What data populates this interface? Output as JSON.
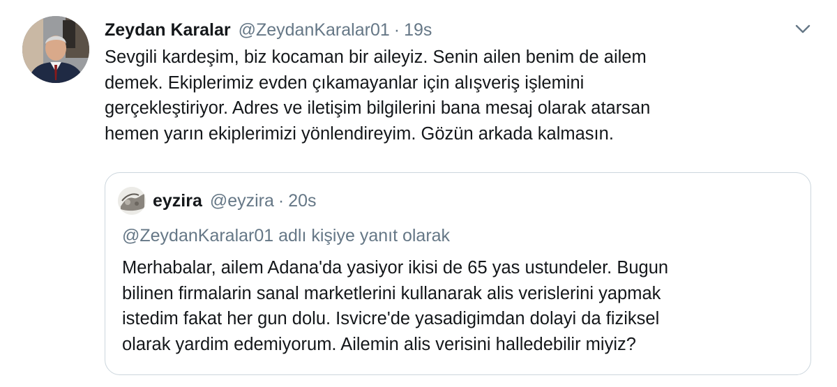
{
  "tweet": {
    "author_name": "Zeydan Karalar",
    "author_handle": "@ZeydanKaralar01",
    "separator": "·",
    "time": "19s",
    "text_lines": [
      "Sevgili kardeşim, biz kocaman bir aileyiz. Senin ailen benim de ailem",
      "demek. Ekiplerimiz evden çıkamayanlar için alışveriş işlemini",
      "gerçekleştiriyor. Adres ve iletişim bilgilerini bana mesaj olarak atarsan",
      "hemen yarın ekiplerimizi yönlendireyim. Gözün arkada kalmasın."
    ]
  },
  "quoted_tweet": {
    "author_name": "eyzira",
    "author_handle": "@eyzira",
    "separator": "·",
    "time": "20s",
    "reply_to": "@ZeydanKaralar01 adlı kişiye yanıt olarak",
    "text_lines": [
      "Merhabalar, ailem Adana'da yasiyor ikisi de 65 yas ustundeler. Bugun",
      "bilinen firmalarin sanal marketlerini kullanarak alis verislerini yapmak",
      "istedim fakat her gun dolu. Isvicre'de yasadigimdan dolayi da fiziksel",
      "olarak yardim edemiyorum. Ailemin alis verisini halledebilir miyiz?"
    ]
  },
  "icons": {
    "menu": "chevron-down-icon",
    "avatar": "profile-photo",
    "quoted_avatar": "profile-photo"
  },
  "colors": {
    "text": "#14171a",
    "secondary_text": "#657786",
    "border": "#ccd6dd"
  }
}
